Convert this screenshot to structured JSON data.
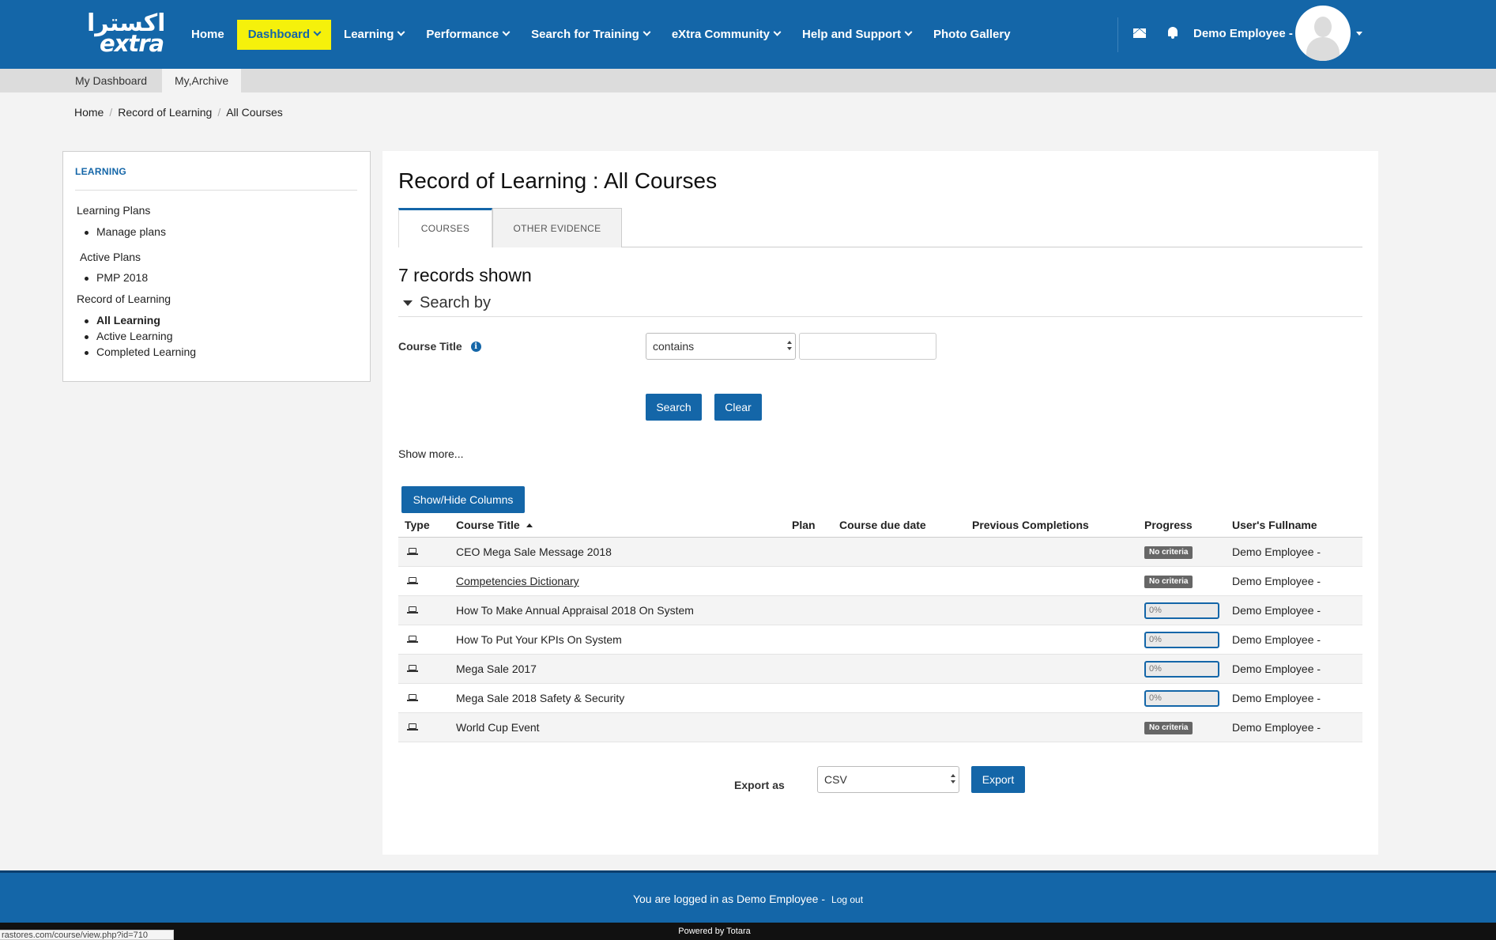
{
  "brand": {
    "logo_ar": "اكسترا",
    "logo_en": "extra"
  },
  "nav": {
    "items": [
      {
        "label": "Home",
        "dropdown": false,
        "active": false
      },
      {
        "label": "Dashboard",
        "dropdown": true,
        "active": true
      },
      {
        "label": "Learning",
        "dropdown": true,
        "active": false
      },
      {
        "label": "Performance",
        "dropdown": true,
        "active": false
      },
      {
        "label": "Search for Training",
        "dropdown": true,
        "active": false
      },
      {
        "label": "eXtra Community",
        "dropdown": true,
        "active": false
      },
      {
        "label": "Help and Support",
        "dropdown": true,
        "active": false
      },
      {
        "label": "Photo Gallery",
        "dropdown": false,
        "active": false
      }
    ],
    "user_name": "Demo Employee -"
  },
  "subnav": {
    "tabs": [
      "My Dashboard",
      "My,Archive"
    ]
  },
  "breadcrumb": [
    "Home",
    "Record of Learning",
    "All Courses"
  ],
  "sidebar": {
    "title": "LEARNING",
    "learning_plans": "Learning Plans",
    "manage_plans": "Manage plans",
    "active_plans": "Active Plans",
    "pmp": "PMP 2018",
    "record_of_learning": "Record of Learning",
    "all_learning": "All Learning",
    "active_learning": "Active Learning",
    "completed_learning": "Completed Learning"
  },
  "main": {
    "title": "Record of Learning : All Courses",
    "tabs": [
      "COURSES",
      "OTHER EVIDENCE"
    ],
    "records_shown": "7 records shown",
    "search_by": "Search by",
    "course_title_label": "Course Title",
    "operator": "contains",
    "search_value": "",
    "search_button": "Search",
    "clear_button": "Clear",
    "show_more": "Show more...",
    "show_hide_columns": "Show/Hide Columns"
  },
  "table": {
    "headers": [
      "Type",
      "Course Title",
      "Plan",
      "Course due date",
      "Previous Completions",
      "Progress",
      "User's Fullname"
    ],
    "rows": [
      {
        "title": "CEO Mega Sale Message 2018",
        "link": false,
        "progress_type": "badge",
        "progress_text": "No criteria",
        "progress_value": null,
        "user": "Demo Employee -"
      },
      {
        "title": "Competencies Dictionary",
        "link": true,
        "progress_type": "badge",
        "progress_text": "No criteria",
        "progress_value": null,
        "user": "Demo Employee -"
      },
      {
        "title": "How To Make Annual Appraisal 2018 On System",
        "link": false,
        "progress_type": "bar",
        "progress_text": "0%",
        "progress_value": 0,
        "user": "Demo Employee -"
      },
      {
        "title": "How To Put Your KPIs On System",
        "link": false,
        "progress_type": "bar",
        "progress_text": "0%",
        "progress_value": 0,
        "user": "Demo Employee -"
      },
      {
        "title": "Mega Sale 2017",
        "link": false,
        "progress_type": "bar",
        "progress_text": "0%",
        "progress_value": 0,
        "user": "Demo Employee -"
      },
      {
        "title": "Mega Sale 2018 Safety & Security",
        "link": false,
        "progress_type": "bar",
        "progress_text": "0%",
        "progress_value": 0,
        "user": "Demo Employee -"
      },
      {
        "title": "World Cup Event",
        "link": false,
        "progress_type": "badge",
        "progress_text": "No criteria",
        "progress_value": null,
        "user": "Demo Employee -"
      }
    ]
  },
  "export": {
    "label": "Export as",
    "format": "CSV",
    "button": "Export"
  },
  "footer": {
    "logged_in": "You are logged in as Demo Employee -",
    "logout": "Log out",
    "powered": "Powered by Totara",
    "status_url": "rastores.com/course/view.php?id=710"
  },
  "colors": {
    "primary": "#1466a8",
    "active_nav": "#f5f10b",
    "badge": "#666666"
  },
  "icons": [
    "mail-icon",
    "bell-icon",
    "info-icon",
    "laptop-icon",
    "avatar-icon"
  ]
}
